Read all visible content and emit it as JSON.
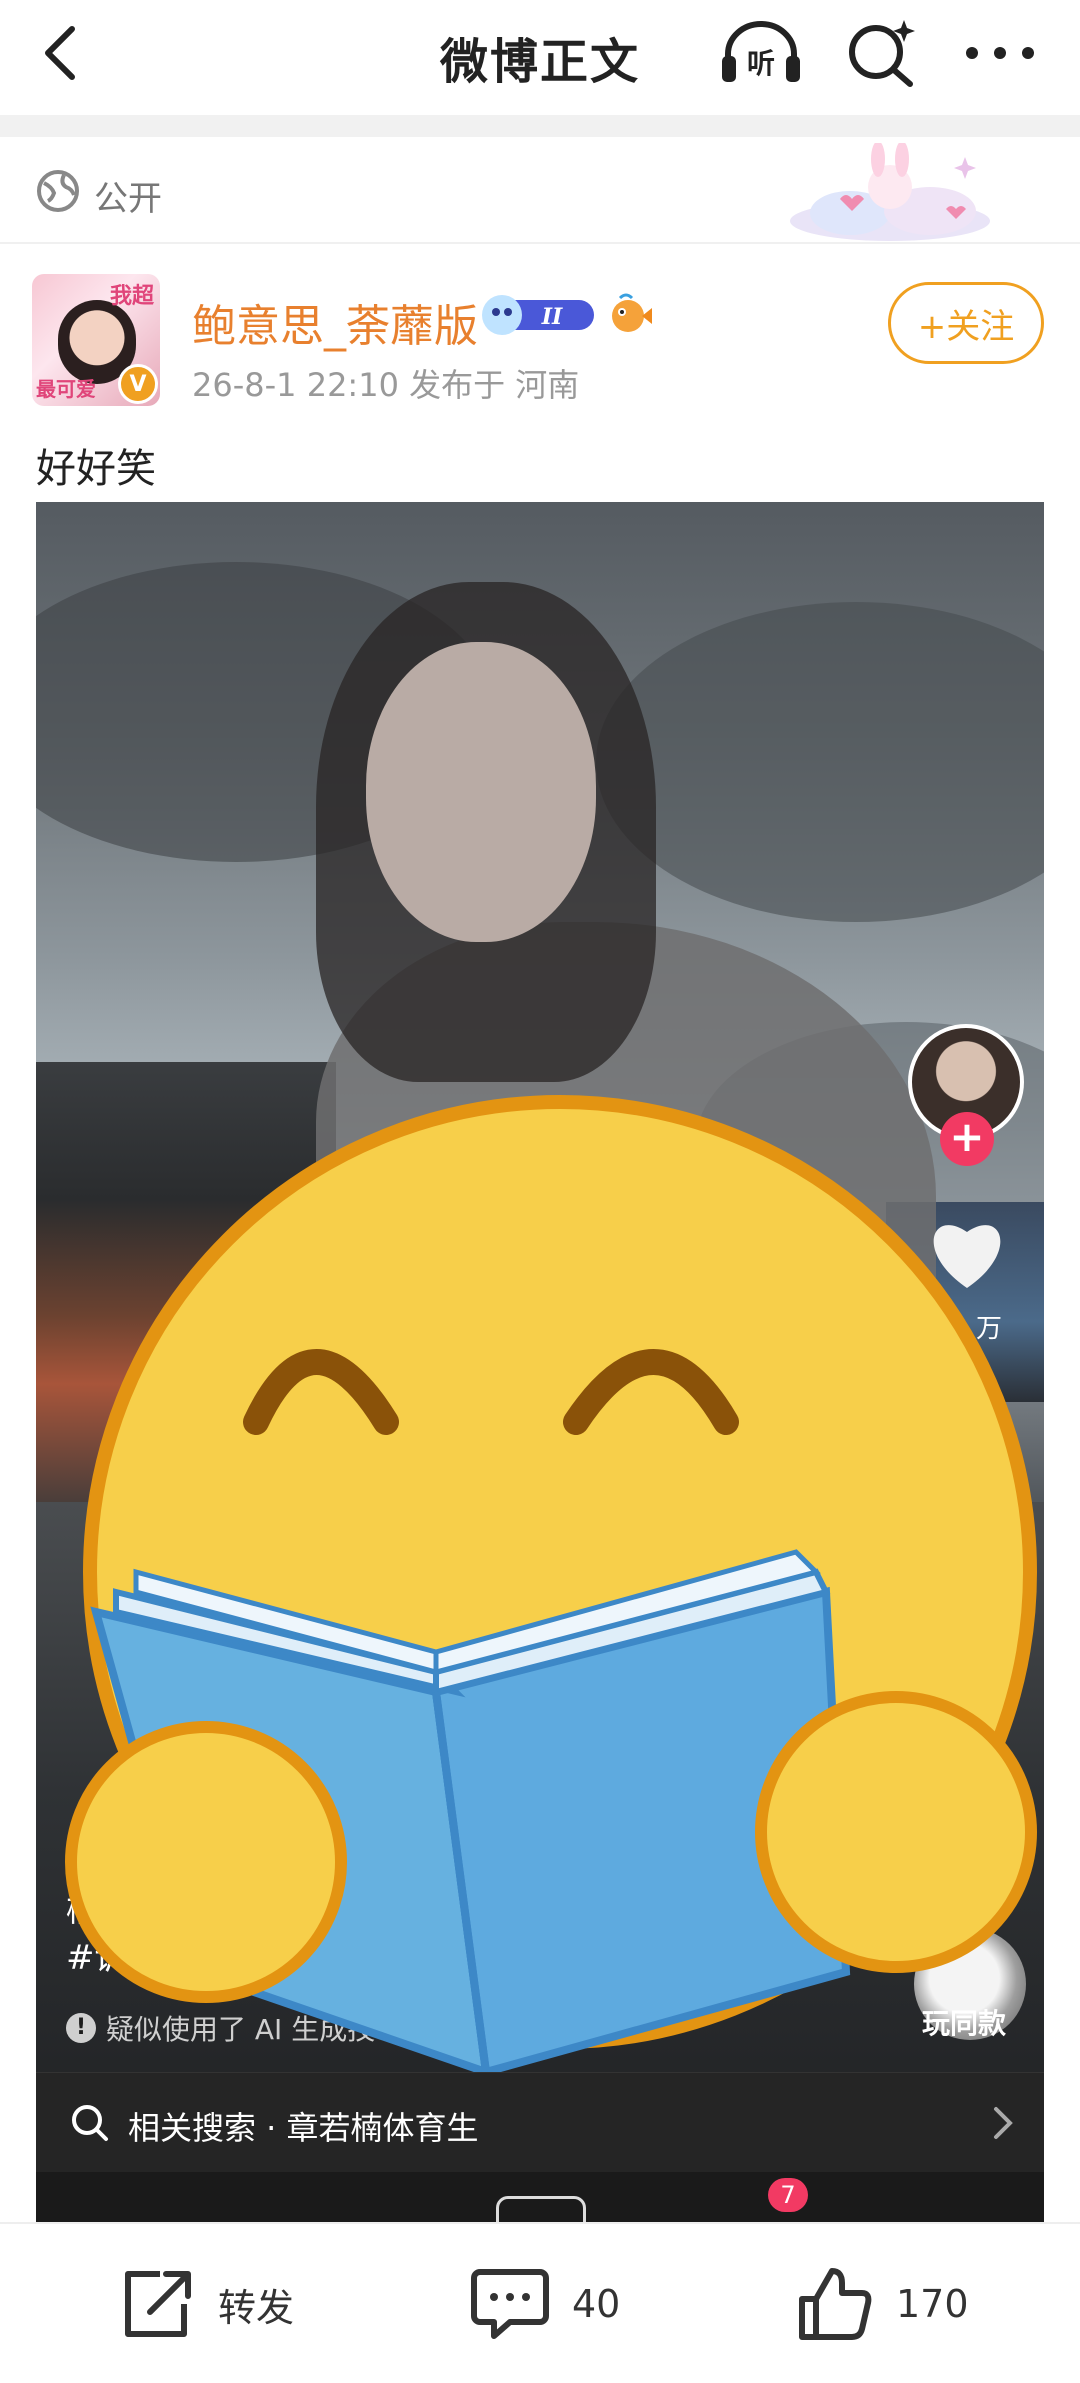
{
  "header": {
    "title": "微博正文",
    "listen_label": "听"
  },
  "visibility": {
    "label": "公开"
  },
  "post": {
    "username": "鲍意思_荼蘼版",
    "level_badge": "II",
    "meta": "26-8-1 22:10  发布于 河南",
    "follow_label": "+关注",
    "text": "好好笑",
    "avatar_tag_top": "我超",
    "avatar_tag_bottom": "最可爱"
  },
  "video": {
    "caption_line1": "楠",
    "hashtags": "#训练 #章若楠",
    "ai_note": "疑似使用了 AI 生成技术，请谨慎甄别",
    "ai_chevron": "›",
    "same_style_label": "玩同款",
    "likes_count": "万",
    "related_search": "相关搜索 · 章若楠体育生",
    "tab_badge": "7"
  },
  "actions": {
    "repost_label": "转发",
    "comment_count": "40",
    "like_count": "170"
  },
  "colors": {
    "accent_orange": "#f0a020",
    "username_orange": "#e8802e",
    "pink": "#f23a63"
  }
}
